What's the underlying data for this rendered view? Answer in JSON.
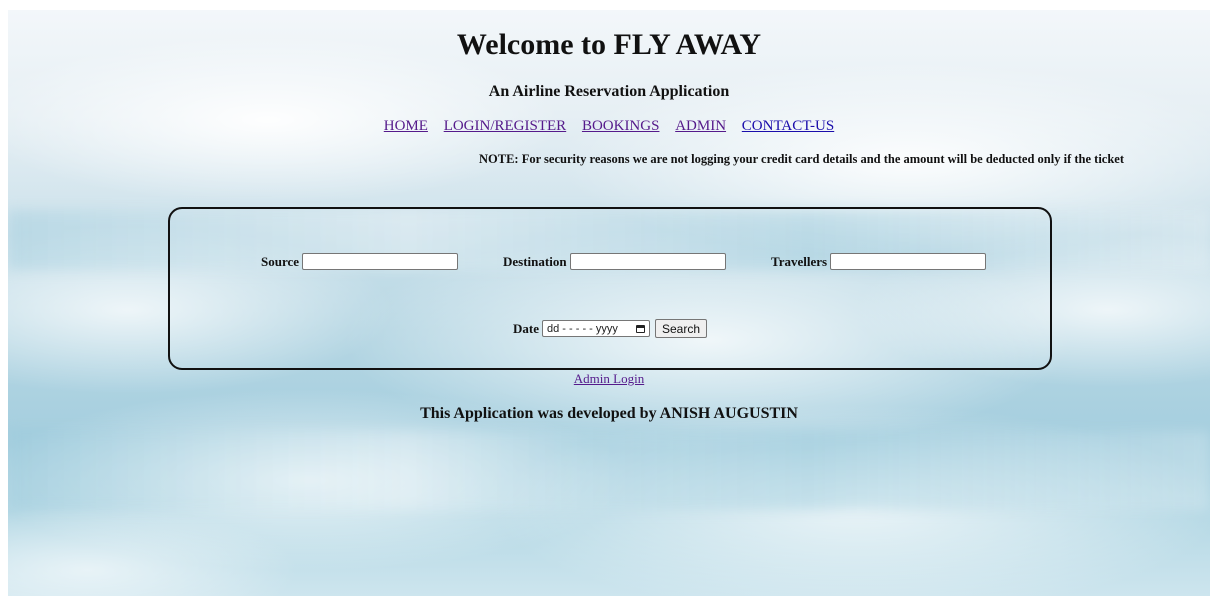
{
  "header": {
    "title": "Welcome to FLY AWAY",
    "subtitle": "An Airline Reservation Application"
  },
  "nav": {
    "items": [
      {
        "label": "HOME"
      },
      {
        "label": "LOGIN/REGISTER"
      },
      {
        "label": "BOOKINGS"
      },
      {
        "label": "ADMIN"
      },
      {
        "label": "CONTACT-US"
      }
    ]
  },
  "note": "NOTE: For security reasons we are not logging your credit card details and the amount will be deducted only if the ticket",
  "search_form": {
    "source_label": "Source",
    "source_value": "",
    "destination_label": "Destination",
    "destination_value": "",
    "travellers_label": "Travellers",
    "travellers_value": "",
    "date_label": "Date",
    "date_placeholder": "dd - - - - - yyyy",
    "search_label": "Search"
  },
  "admin_login": "Admin Login",
  "footer": "This Application was developed by ANISH AUGUSTIN",
  "colors": {
    "visited_link": "#551a8b",
    "unvisited_link": "#1a0dab",
    "panel_border": "#111111"
  },
  "icons": {
    "date_picker": "calendar-icon"
  }
}
